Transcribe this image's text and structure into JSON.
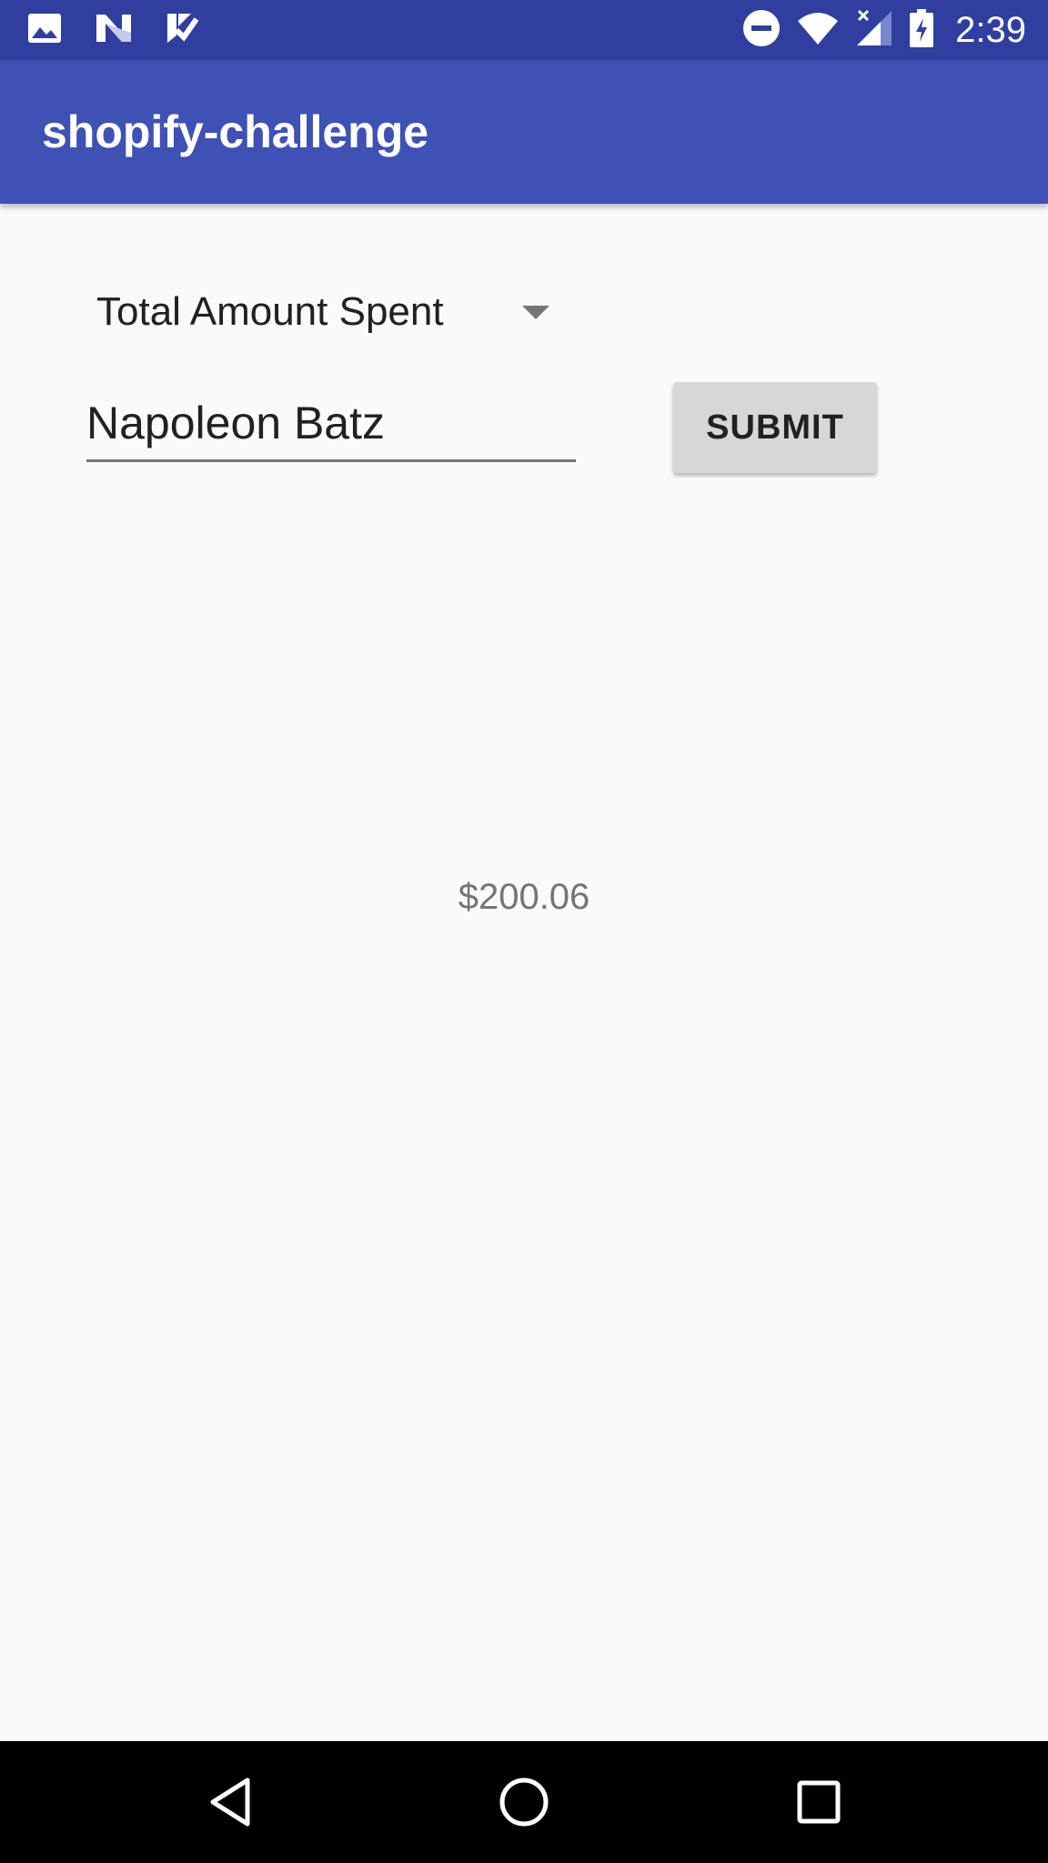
{
  "status_bar": {
    "time": "2:39",
    "icons_left": [
      "image-icon",
      "n-app-icon",
      "checklist-icon"
    ],
    "icons_right": [
      "do-not-disturb-icon",
      "wifi-icon",
      "cell-signal-icon",
      "battery-charging-icon"
    ]
  },
  "app_bar": {
    "title": "shopify-challenge"
  },
  "form": {
    "spinner_selected": "Total Amount Spent",
    "name_value": "Napoleon Batz",
    "submit_label": "SUBMIT"
  },
  "result": {
    "text": "$200.06"
  },
  "nav_bar": {
    "buttons": [
      "back-icon",
      "home-icon",
      "recents-icon"
    ]
  },
  "colors": {
    "status_bar": "#303f9f",
    "app_bar": "#3f51b5",
    "background": "#fafafa",
    "button": "#d6d7d7"
  }
}
